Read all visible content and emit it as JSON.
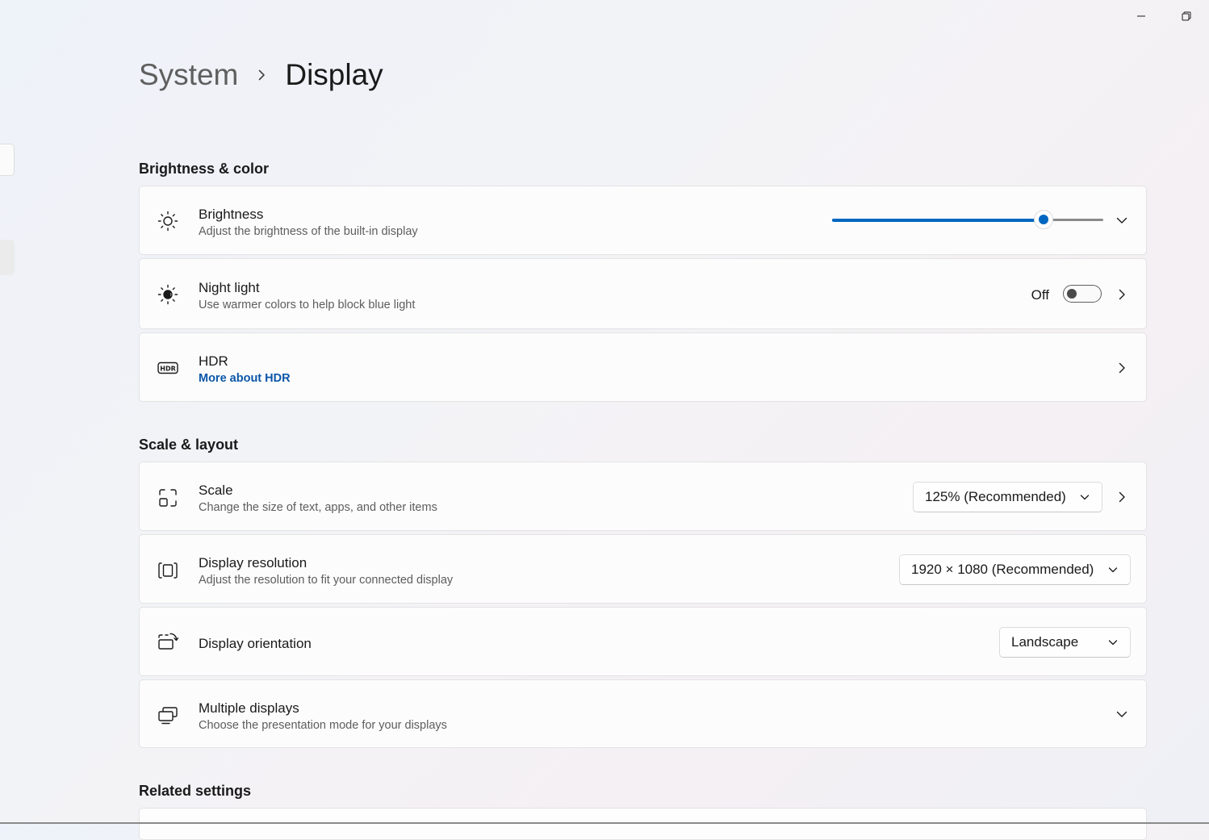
{
  "window": {
    "minimize_icon": "minimize-icon",
    "restore_icon": "restore-icon"
  },
  "breadcrumb": {
    "parent": "System",
    "current": "Display"
  },
  "sections": {
    "brightness_color": "Brightness & color",
    "scale_layout": "Scale & layout",
    "related_settings": "Related settings"
  },
  "brightness": {
    "title": "Brightness",
    "description": "Adjust the brightness of the built-in display",
    "value": 0.78,
    "icon": "sun-icon"
  },
  "night_light": {
    "title": "Night light",
    "description": "Use warmer colors to help block blue light",
    "state_label": "Off",
    "enabled": false,
    "icon": "night-light-icon"
  },
  "hdr": {
    "title": "HDR",
    "link": "More about HDR",
    "icon": "hdr-icon"
  },
  "scale": {
    "title": "Scale",
    "description": "Change the size of text, apps, and other items",
    "selected": "125% (Recommended)",
    "icon": "scale-icon"
  },
  "resolution": {
    "title": "Display resolution",
    "description": "Adjust the resolution to fit your connected display",
    "selected": "1920 × 1080 (Recommended)",
    "icon": "resolution-icon"
  },
  "orientation": {
    "title": "Display orientation",
    "selected": "Landscape",
    "icon": "orientation-icon"
  },
  "multiple_displays": {
    "title": "Multiple displays",
    "description": "Choose the presentation mode for your displays",
    "icon": "multiple-displays-icon"
  },
  "colors": {
    "accent": "#0067c0",
    "link": "#0b57a8"
  }
}
